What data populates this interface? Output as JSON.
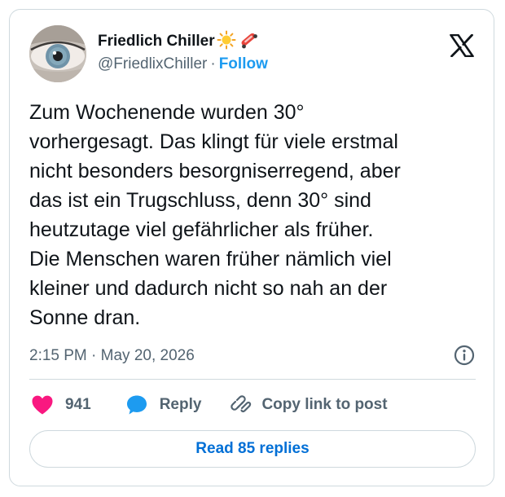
{
  "author": {
    "display_name": "Friedlich Chiller",
    "name_emojis": [
      "sun-emoji",
      "skateboard-emoji"
    ],
    "handle": "@FriedlixChiller",
    "separator": "·",
    "follow_label": "Follow"
  },
  "platform_icon": "x-logo-icon",
  "tweet": {
    "text": "Zum Wochenende wurden 30°\nvorhergesagt. Das klingt für viele erstmal\nnicht besonders besorgniserregend, aber\ndas ist ein Trugschluss, denn 30° sind\nheutzutage viel gefährlicher als früher.\nDie Menschen waren früher nämlich viel\nkleiner und dadurch nicht so nah an der\nSonne dran.",
    "timestamp": "2:15 PM · May 20, 2026"
  },
  "actions": {
    "like_count": "941",
    "reply_label": "Reply",
    "copy_link_label": "Copy link to post"
  },
  "read_replies_label": "Read 85 replies",
  "colors": {
    "accent": "#1d9bf0",
    "like": "#f91880",
    "reply": "#1d9bf0",
    "text": "#0f1419",
    "secondary_text": "#536471",
    "border": "#cfd9de"
  }
}
